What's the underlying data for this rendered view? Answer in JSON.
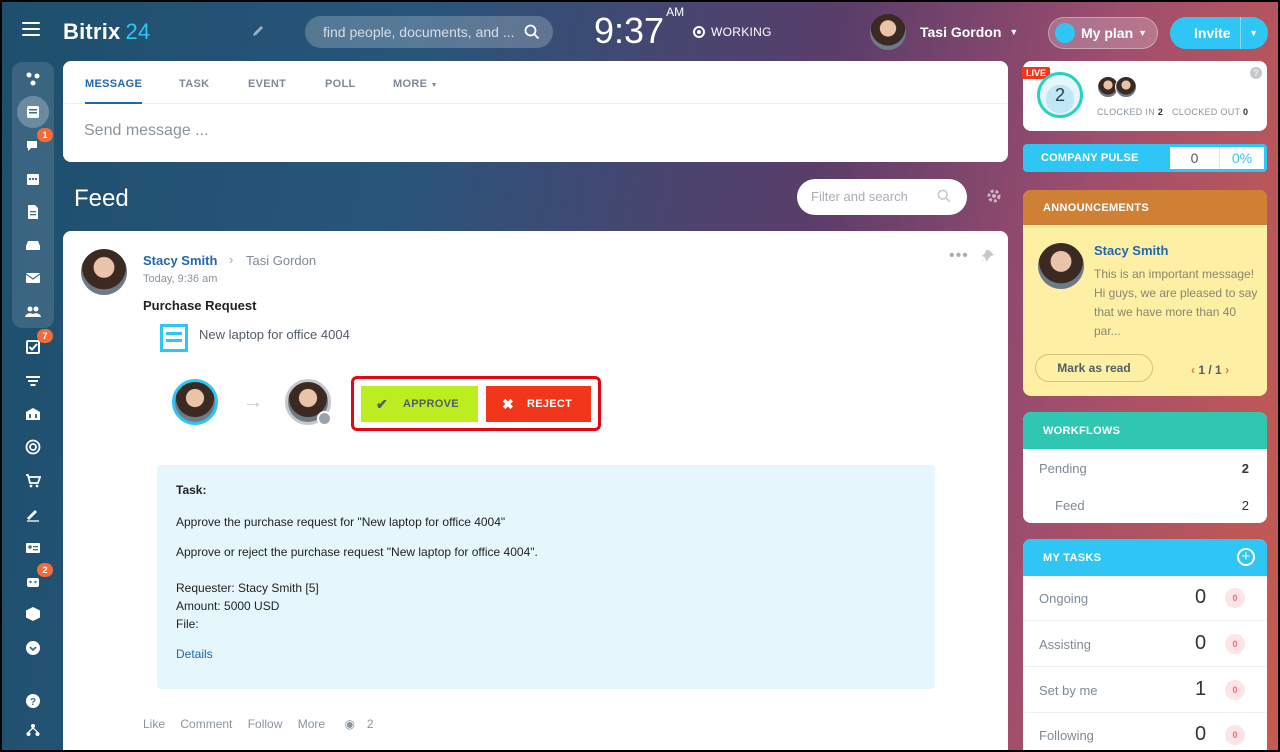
{
  "header": {
    "logo_name": "Bitrix",
    "logo_num": "24",
    "search_placeholder": "find people, documents, and ...",
    "time": "9:37",
    "ampm": "AM",
    "status": "WORKING",
    "user_name": "Tasi Gordon",
    "my_plan": "My plan",
    "invite": "Invite"
  },
  "sidebar": {
    "badges": {
      "chat": "1",
      "tasks": "7",
      "robots": "2"
    }
  },
  "composer": {
    "tabs": [
      "MESSAGE",
      "TASK",
      "EVENT",
      "POLL",
      "MORE"
    ],
    "placeholder": "Send message ..."
  },
  "feed": {
    "title": "Feed",
    "filter_placeholder": "Filter and search"
  },
  "post": {
    "author": "Stacy Smith",
    "recipient": "Tasi Gordon",
    "time": "Today, 9:36 am",
    "title": "Purchase Request",
    "document": "New laptop for office 4004",
    "approve": "APPROVE",
    "reject": "REJECT",
    "task_heading": "Task:",
    "task_line1": "Approve the purchase request for \"New laptop for office 4004\"",
    "task_line2": "Approve or reject the purchase request \"New laptop for office 4004\".",
    "requester": "Requester: Stacy Smith [5]",
    "amount": "Amount: 5000 USD",
    "file": "File:",
    "details": "Details",
    "links": [
      "Like",
      "Comment",
      "Follow",
      "More"
    ],
    "views": "2"
  },
  "timeman": {
    "live": "LIVE",
    "count": "2",
    "clocked_in_label": "CLOCKED IN",
    "clocked_in_value": "2",
    "clocked_out_label": "CLOCKED OUT",
    "clocked_out_value": "0"
  },
  "pulse": {
    "label": "COMPANY PULSE",
    "value": "0",
    "percent": "0%"
  },
  "announcements": {
    "header": "ANNOUNCEMENTS",
    "author": "Stacy Smith",
    "text": "This is an important message! Hi guys, we are pleased to say that we have more than 40 par...",
    "mark_read": "Mark as read",
    "page_current": "1",
    "page_total": "1"
  },
  "workflows": {
    "header": "WORKFLOWS",
    "rows": [
      {
        "label": "Pending",
        "value": "2"
      },
      {
        "label": "Feed",
        "value": "2"
      }
    ]
  },
  "my_tasks": {
    "header": "MY TASKS",
    "rows": [
      {
        "label": "Ongoing",
        "value": "0",
        "counter": "0"
      },
      {
        "label": "Assisting",
        "value": "0",
        "counter": "0"
      },
      {
        "label": "Set by me",
        "value": "1",
        "counter": "0"
      },
      {
        "label": "Following",
        "value": "0",
        "counter": "0"
      }
    ]
  },
  "colors": {
    "accent": "#2fc6f6",
    "approve": "#bbed21",
    "reject": "#f1361b",
    "highlight": "#e30613"
  }
}
